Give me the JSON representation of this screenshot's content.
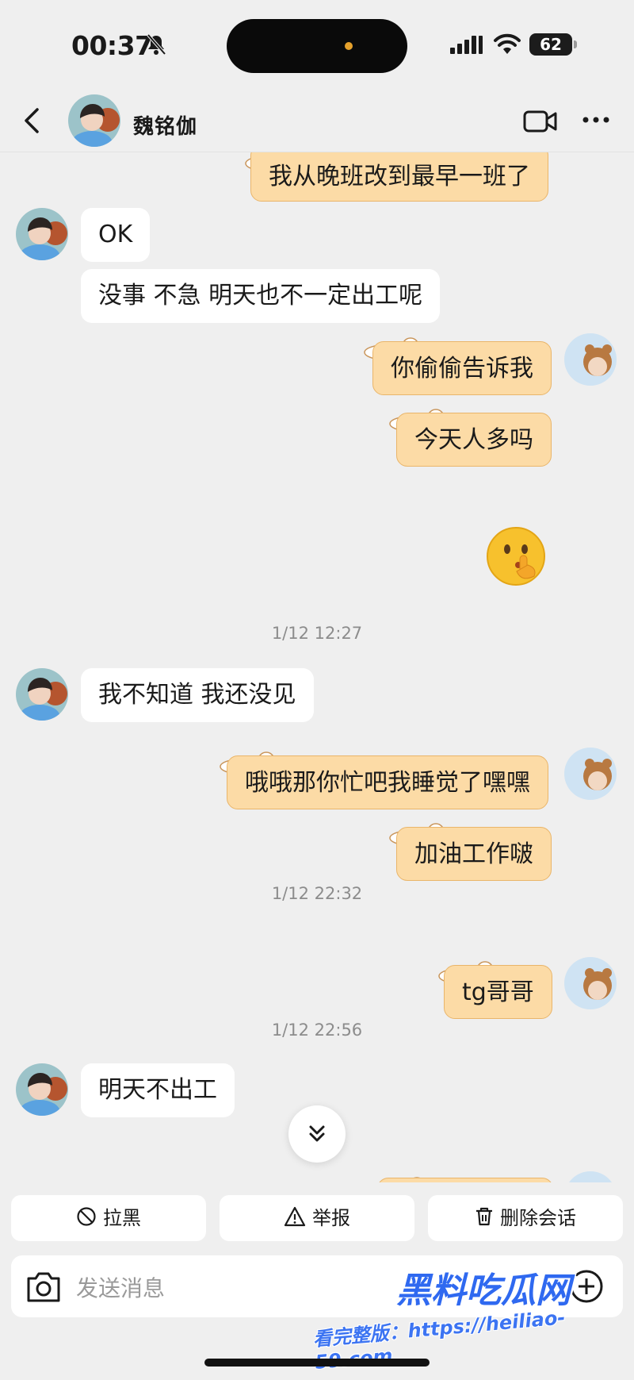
{
  "status_bar": {
    "time": "00:37",
    "battery": "62",
    "battery_level": 0.62
  },
  "header": {
    "contact_name": "魏铭伽"
  },
  "chat": {
    "messages": [
      {
        "side": "out",
        "text": "我从晚班改到最早一班了"
      },
      {
        "side": "in",
        "text": "OK"
      },
      {
        "side": "in",
        "text": "没事 不急 明天也不一定出工呢"
      },
      {
        "side": "out",
        "text": "你偷偷告诉我"
      },
      {
        "side": "out",
        "text": "今天人多吗"
      },
      {
        "side": "out",
        "text": "🤫"
      },
      {
        "side": "in",
        "text": "我不知道 我还没见"
      },
      {
        "side": "out",
        "text": "哦哦那你忙吧我睡觉了嘿嘿"
      },
      {
        "side": "out",
        "text": "加油工作啵"
      },
      {
        "side": "out",
        "text": "tg哥哥"
      },
      {
        "side": "in",
        "text": "明天不出工"
      }
    ],
    "timestamps": [
      "1/12 12:27",
      "1/12 22:32",
      "1/12 22:56"
    ]
  },
  "actions": {
    "block": "拉黑",
    "report": "举报",
    "delete": "删除会话"
  },
  "input": {
    "placeholder": "发送消息"
  },
  "watermark": {
    "brand": "黑料吃瓜网",
    "url_line": "看完整版：https://heiliao-59.com"
  }
}
